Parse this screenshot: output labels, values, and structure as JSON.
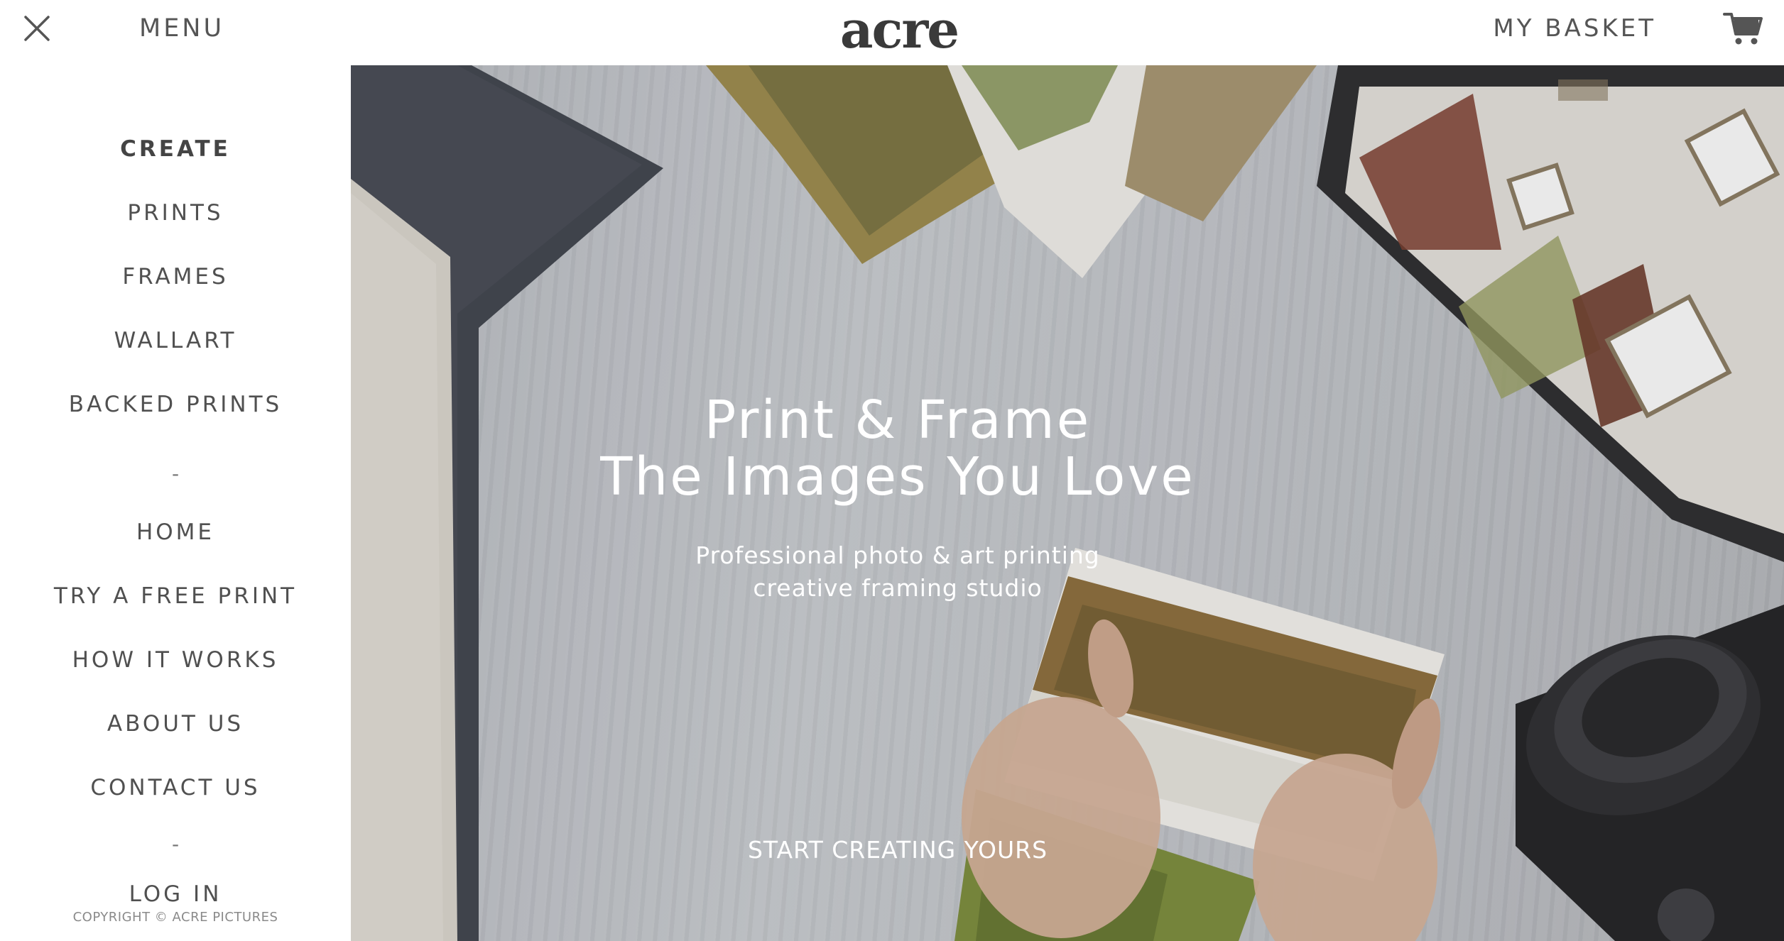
{
  "header": {
    "menu_label": "MENU",
    "logo_text": "acre",
    "basket_label": "MY BASKET"
  },
  "icons": {
    "close": "close-icon",
    "cart": "cart-icon"
  },
  "sidebar": {
    "items": [
      {
        "label": "CREATE",
        "active": true
      },
      {
        "label": "PRINTS"
      },
      {
        "label": "FRAMES"
      },
      {
        "label": "WALLART"
      },
      {
        "label": "BACKED PRINTS"
      },
      {
        "label": "-",
        "separator": true
      },
      {
        "label": "HOME"
      },
      {
        "label": "TRY A FREE PRINT"
      },
      {
        "label": "HOW IT WORKS"
      },
      {
        "label": "ABOUT US"
      },
      {
        "label": "CONTACT US"
      },
      {
        "label": "-",
        "separator": true
      },
      {
        "label": "LOG IN"
      }
    ],
    "copyright": "COPYRIGHT © ACRE PICTURES"
  },
  "hero": {
    "title_line1": "Print & Frame",
    "title_line2": "The Images You Love",
    "subtitle_line1": "Professional photo & art printing",
    "subtitle_line2": "creative framing studio",
    "cta_label": "START CREATING YOURS"
  },
  "colors": {
    "text": "#4a4a4a",
    "background": "#ffffff",
    "hero_text": "#ffffff"
  }
}
